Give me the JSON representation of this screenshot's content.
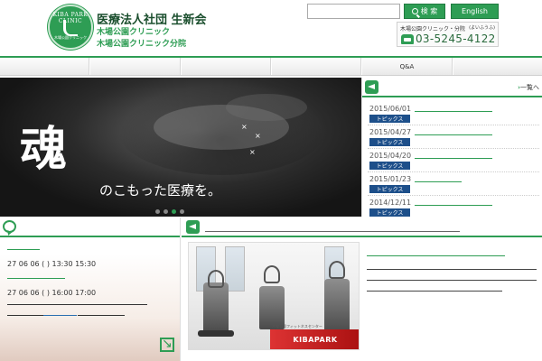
{
  "header": {
    "logo_ring_text": "KIBA PARK CLINIC",
    "logo_sub_text": "木場公園クリニック",
    "corp_name": "医療法人社団 生新会",
    "clinics": [
      "木場公園クリニック",
      "木場公園クリニック分院"
    ]
  },
  "search": {
    "placeholder": "",
    "button_label": "検 索"
  },
  "english_label": "English",
  "tel": {
    "label": "木場公園クリニック・分院",
    "kana": "(よいふうふ)",
    "number": "03-5245-4122"
  },
  "nav": {
    "items": [
      "",
      "",
      "",
      "",
      "Q&A",
      ""
    ]
  },
  "hero": {
    "kanji": "魂",
    "text": "のこもった医療を。",
    "active_slide": 2,
    "slide_count": 4
  },
  "topics": {
    "title": "",
    "more": "一覧へ",
    "items": [
      {
        "date": "2015/06/01",
        "tag": "トピックス",
        "link_frac": 0.95
      },
      {
        "date": "2015/04/27",
        "tag": "トピックス",
        "link_frac": 0.95
      },
      {
        "date": "2015/04/20",
        "tag": "トピックス",
        "link_frac": 0.95
      },
      {
        "date": "2015/01/23",
        "tag": "トピックス",
        "link_frac": 0.58
      },
      {
        "date": "2014/12/11",
        "tag": "トピックス",
        "link_frac": 0.95
      }
    ]
  },
  "events": {
    "title": "",
    "items": [
      {
        "date_text": "27 06 06 ( ) 13:30 15:30"
      },
      {
        "date_text": "27 06 06 ( ) 16:00 17:00"
      }
    ]
  },
  "feature": {
    "title": "",
    "banner": "KIBAPARK",
    "banner_sub": "木場公園フィットネスセンター"
  },
  "colors": {
    "brand_green": "#2e9d54",
    "topic_tag_blue": "#1d4f8a",
    "link_blue": "#2b6fb0"
  }
}
